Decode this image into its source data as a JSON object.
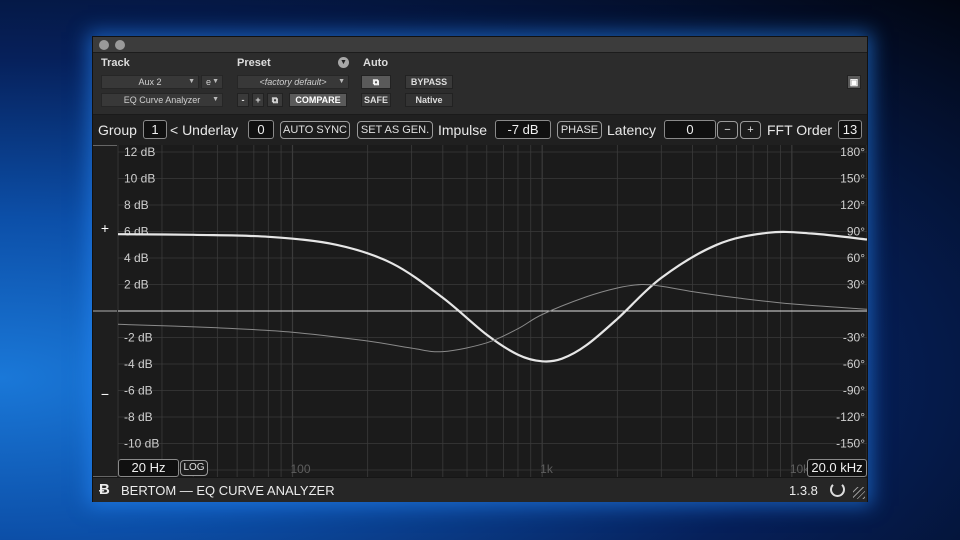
{
  "host": {
    "track_label": "Track",
    "track_name": "Aux 2",
    "track_channel": "e",
    "insert_name": "EQ Curve Analyzer",
    "preset_label": "Preset",
    "preset_value": "<factory default>",
    "preset_minus": "-",
    "preset_plus": "+",
    "compare_label": "COMPARE",
    "auto_label": "Auto",
    "safe_label": "SAFE",
    "bypass_label": "BYPASS",
    "native_label": "Native"
  },
  "controls": {
    "group_label": "Group",
    "group_value": "1",
    "underlay_label": "< Underlay",
    "underlay_value": "0",
    "auto_sync_label": "AUTO SYNC",
    "set_as_gen_label": "SET AS GEN.",
    "impulse_label": "Impulse",
    "impulse_value": "-7 dB",
    "phase_label": "PHASE",
    "latency_label": "Latency",
    "latency_value": "0",
    "latency_minus": "−",
    "latency_plus": "+",
    "fft_label": "FFT Order",
    "fft_value": "13"
  },
  "plot": {
    "zoom_in": "+",
    "zoom_out": "−",
    "freq_min_label": "20 Hz",
    "log_label": "LOG",
    "freq_max_label": "20.0 kHz",
    "colors": {
      "background": "#1b1b1b",
      "grid": "#3b3b3b",
      "curve": "#e6e6e6",
      "phase": "#8a8a8a"
    }
  },
  "chart_data": {
    "type": "line",
    "xscale": "log",
    "xlim": [
      20,
      20000
    ],
    "ylim": [
      -12,
      12
    ],
    "y2lim": [
      -180,
      180
    ],
    "x_ticks": [
      {
        "value": 100,
        "label": "100"
      },
      {
        "value": 1000,
        "label": "1k"
      },
      {
        "value": 10000,
        "label": "10k"
      }
    ],
    "y_ticks": [
      {
        "value": 12,
        "label": "12 dB"
      },
      {
        "value": 10,
        "label": "10 dB"
      },
      {
        "value": 8,
        "label": "8 dB"
      },
      {
        "value": 6,
        "label": "6 dB"
      },
      {
        "value": 4,
        "label": "4 dB"
      },
      {
        "value": 2,
        "label": "2 dB"
      },
      {
        "value": -2,
        "label": "-2 dB"
      },
      {
        "value": -4,
        "label": "-4 dB"
      },
      {
        "value": -6,
        "label": "-6 dB"
      },
      {
        "value": -8,
        "label": "-8 dB"
      },
      {
        "value": -10,
        "label": "-10 dB"
      }
    ],
    "y2_ticks": [
      {
        "value": 180,
        "label": "180°"
      },
      {
        "value": 150,
        "label": "150°"
      },
      {
        "value": 120,
        "label": "120°"
      },
      {
        "value": 90,
        "label": "90°"
      },
      {
        "value": 60,
        "label": "60°"
      },
      {
        "value": 30,
        "label": "30°"
      },
      {
        "value": -30,
        "label": "-30°"
      },
      {
        "value": -60,
        "label": "-60°"
      },
      {
        "value": -90,
        "label": "-90°"
      },
      {
        "value": -120,
        "label": "-120°"
      },
      {
        "value": -150,
        "label": "-150°"
      }
    ],
    "series": [
      {
        "axis": "magnitude",
        "x": [
          20,
          40,
          80,
          150,
          250,
          400,
          600,
          800,
          1000,
          1200,
          1500,
          2000,
          3000,
          5000,
          8000,
          12000,
          20000
        ],
        "y": [
          5.8,
          5.75,
          5.6,
          5.0,
          3.6,
          1.0,
          -1.8,
          -3.3,
          -3.8,
          -3.6,
          -2.6,
          -0.6,
          2.5,
          5.0,
          5.9,
          5.85,
          5.4
        ]
      },
      {
        "axis": "phase",
        "x": [
          20,
          50,
          100,
          200,
          300,
          400,
          600,
          800,
          1000,
          1500,
          2000,
          2500,
          3000,
          4000,
          6000,
          10000,
          20000
        ],
        "y": [
          -15,
          -19,
          -24,
          -34,
          -42,
          -46,
          -36,
          -20,
          -4,
          16,
          26,
          30,
          28,
          22,
          15,
          8,
          2
        ]
      }
    ]
  },
  "footer": {
    "brand": "BERTOM — EQ CURVE ANALYZER",
    "version": "1.3.8"
  }
}
